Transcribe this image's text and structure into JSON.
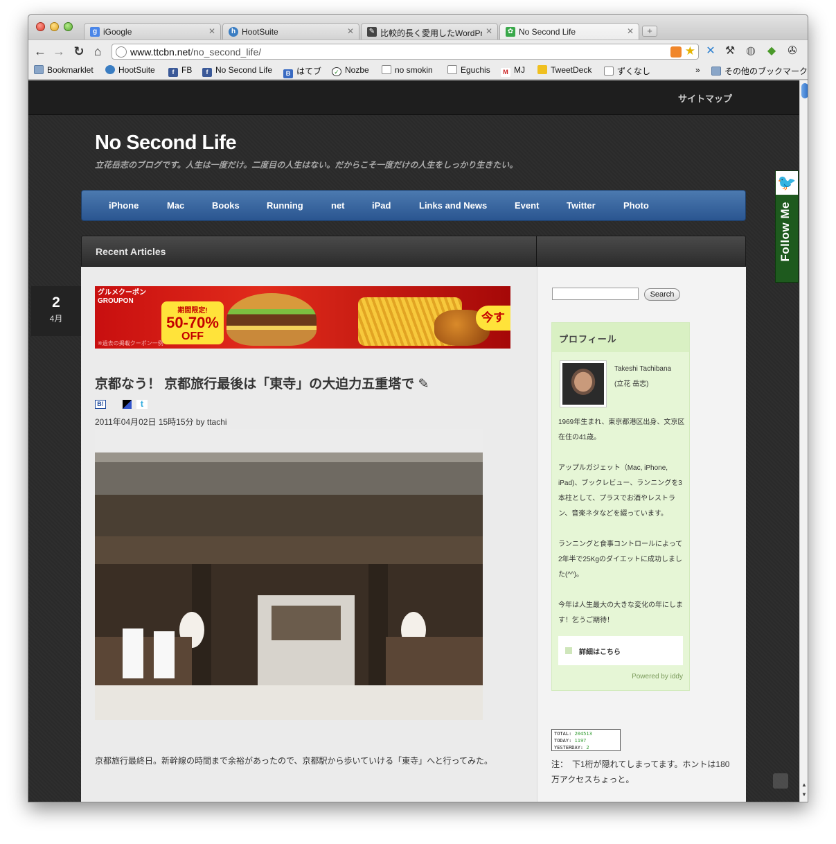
{
  "browser": {
    "tabs": [
      {
        "title": "iGoogle",
        "favicon": "google-icon",
        "active": false
      },
      {
        "title": "HootSuite",
        "favicon": "hootsuite-icon",
        "active": false
      },
      {
        "title": "比較的長く愛用したWordPress",
        "favicon": "page-icon",
        "active": false
      },
      {
        "title": "No Second Life",
        "favicon": "nsl-icon",
        "active": true
      }
    ],
    "url": {
      "host": "www.ttcbn.net",
      "path": "/no_second_life/"
    },
    "bookmarks": [
      {
        "label": "Bookmarklet",
        "icon": "folder-icon"
      },
      {
        "label": "HootSuite",
        "icon": "hootsuite-icon"
      },
      {
        "label": "FB",
        "icon": "facebook-icon"
      },
      {
        "label": "No Second Life",
        "icon": "facebook-icon"
      },
      {
        "label": "はてブ",
        "icon": "hatena-icon"
      },
      {
        "label": "Nozbe",
        "icon": "nozbe-icon"
      },
      {
        "label": "no smokin",
        "icon": "page-icon"
      },
      {
        "label": "Eguchis",
        "icon": "page-icon"
      },
      {
        "label": "MJ",
        "icon": "mj-icon"
      },
      {
        "label": "TweetDeck",
        "icon": "tweetdeck-icon"
      },
      {
        "label": "ずくなし",
        "icon": "page-icon"
      }
    ],
    "more_bookmarks": "»",
    "other_bookmarks": "その他のブックマーク"
  },
  "site": {
    "sitemap": "サイトマップ",
    "title": "No Second Life",
    "tagline": "立花岳志のブログです。人生は一度だけ。二度目の人生はない。だからこそ一度だけの人生をしっかり生きたい。",
    "nav": [
      "iPhone",
      "Mac",
      "Books",
      "Running",
      "net",
      "iPad",
      "Links and News",
      "Event",
      "Twitter",
      "Photo"
    ],
    "section_label": "Recent Articles",
    "accent_color": "#2f5e97"
  },
  "post": {
    "date_day": "2",
    "date_month": "4月",
    "banner": {
      "brand_line1": "グルメクーポン",
      "brand_line2": "GROUPON",
      "offer_top": "期間限定!",
      "offer_pct": "50-70%",
      "offer_bottom": "OFF",
      "cta": "今す",
      "fine_print": "※過去の掲載クーポン一例"
    },
    "title": "京都なう！ 京都旅行最後は「東寺」の大迫力五重塔で",
    "share_hatena": "B!",
    "meta": "2011年04月02日 15時15分 by ttachi",
    "body": "京都旅行最終日。新幹線の時間まで余裕があったので、京都駅から歩いていける「東寺」へと行ってみた。"
  },
  "sidebar": {
    "search_button": "Search",
    "search_placeholder": "",
    "profile": {
      "heading": "プロフィール",
      "name_en": "Takeshi Tachibana",
      "name_jp": "(立花 岳志)",
      "bio": [
        "1969年生まれ、東京都港区出身、文京区在住の41歳。",
        "アップルガジェット（Mac, iPhone, iPad)、ブックレビュー、ランニングを3本柱として、プラスでお酒やレストラン、音楽ネタなどを綴っています。",
        "ランニングと食事コントロールによって2年半で25Kgのダイエットに成功しました(^^)。",
        "今年は人生最大の大きな変化の年にします！乞うご期待！"
      ],
      "details_link": "詳細はこちら",
      "powered_by": "Powered by iddy"
    },
    "counter": {
      "total_label": "TOTAL:",
      "total": "204513",
      "today_label": "TODAY:",
      "today": "1197",
      "yesterday_label": "YESTERDAY:",
      "yesterday": "2"
    },
    "note": "注：　下1桁が隠れてしまってます。ホントは180万アクセスちょっと。"
  },
  "follow_me": "Follow Me"
}
